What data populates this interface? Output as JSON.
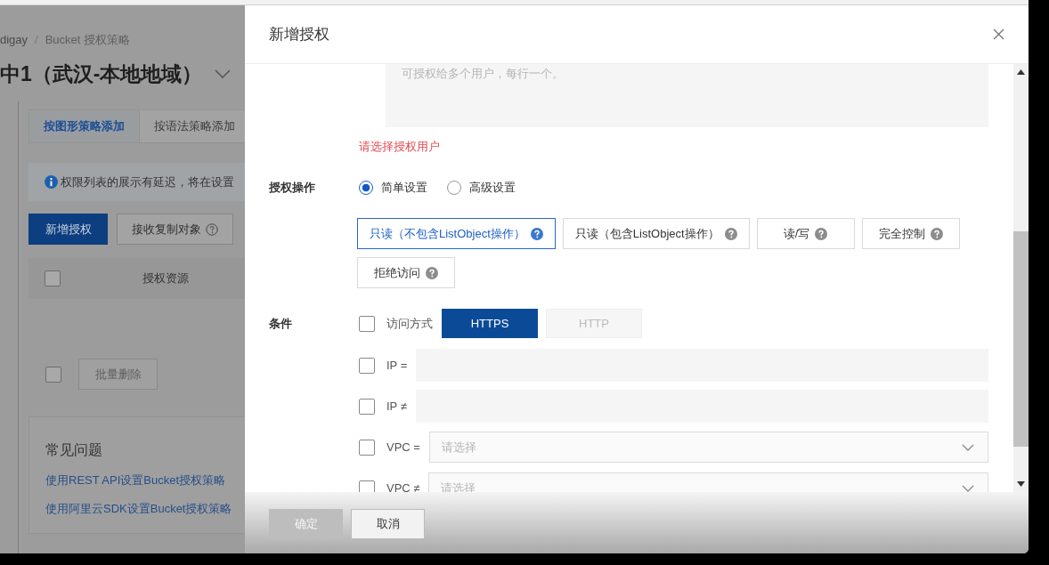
{
  "background_page": {
    "breadcrumb": [
      "digay",
      "/",
      "Bucket 授权策略"
    ],
    "region_title": "中1（武汉-本地地域）",
    "tabs": [
      {
        "label": "按图形策略添加",
        "selected": true
      },
      {
        "label": "按语法策略添加",
        "selected": false
      }
    ],
    "notice": "权限列表的展示有延迟，将在设置",
    "buttons": [
      {
        "label": "新增授权",
        "kind": "primary"
      },
      {
        "label": "接收复制对象",
        "kind": "help"
      }
    ],
    "table": {
      "columns": [
        "授权资源"
      ],
      "select_all": {
        "checked": false
      }
    },
    "bulk": {
      "checked": false,
      "button": {
        "label": "批量删除",
        "disabled": true
      }
    },
    "faq": {
      "title": "常见问题",
      "links": [
        "使用REST API设置Bucket授权策略",
        "使用阿里云SDK设置Bucket授权策略"
      ]
    }
  },
  "dialog": {
    "title": "新增授权",
    "users_field": {
      "placeholder": "可授权给多个用户，每行一个。"
    },
    "users_error": "请选择授权用户",
    "operation": {
      "label": "授权操作",
      "modes": [
        {
          "label": "简单设置",
          "selected": true
        },
        {
          "label": "高级设置",
          "selected": false
        }
      ],
      "permissions": [
        {
          "label": "只读（不包含ListObject操作）",
          "selected": true
        },
        {
          "label": "只读（包含ListObject操作）",
          "selected": false
        },
        {
          "label": "读/写",
          "selected": false
        },
        {
          "label": "完全控制",
          "selected": false
        },
        {
          "label": "拒绝访问",
          "selected": false
        }
      ]
    },
    "conditions": {
      "label": "条件",
      "rows": [
        {
          "kind": "protocol",
          "label": "访问方式",
          "checked": false,
          "options": [
            {
              "label": "HTTPS",
              "selected": true
            },
            {
              "label": "HTTP",
              "selected": false
            }
          ]
        },
        {
          "kind": "text",
          "label": "IP =",
          "checked": false
        },
        {
          "kind": "text",
          "label": "IP ≠",
          "checked": false
        },
        {
          "kind": "select",
          "label": "VPC =",
          "checked": false,
          "placeholder": "请选择"
        },
        {
          "kind": "select",
          "label": "VPC ≠",
          "checked": false,
          "placeholder": "请选择"
        }
      ]
    },
    "footer_buttons": [
      {
        "label": "确定",
        "kind": "primary",
        "disabled": true
      },
      {
        "label": "取消",
        "kind": "default",
        "disabled": false
      }
    ]
  }
}
